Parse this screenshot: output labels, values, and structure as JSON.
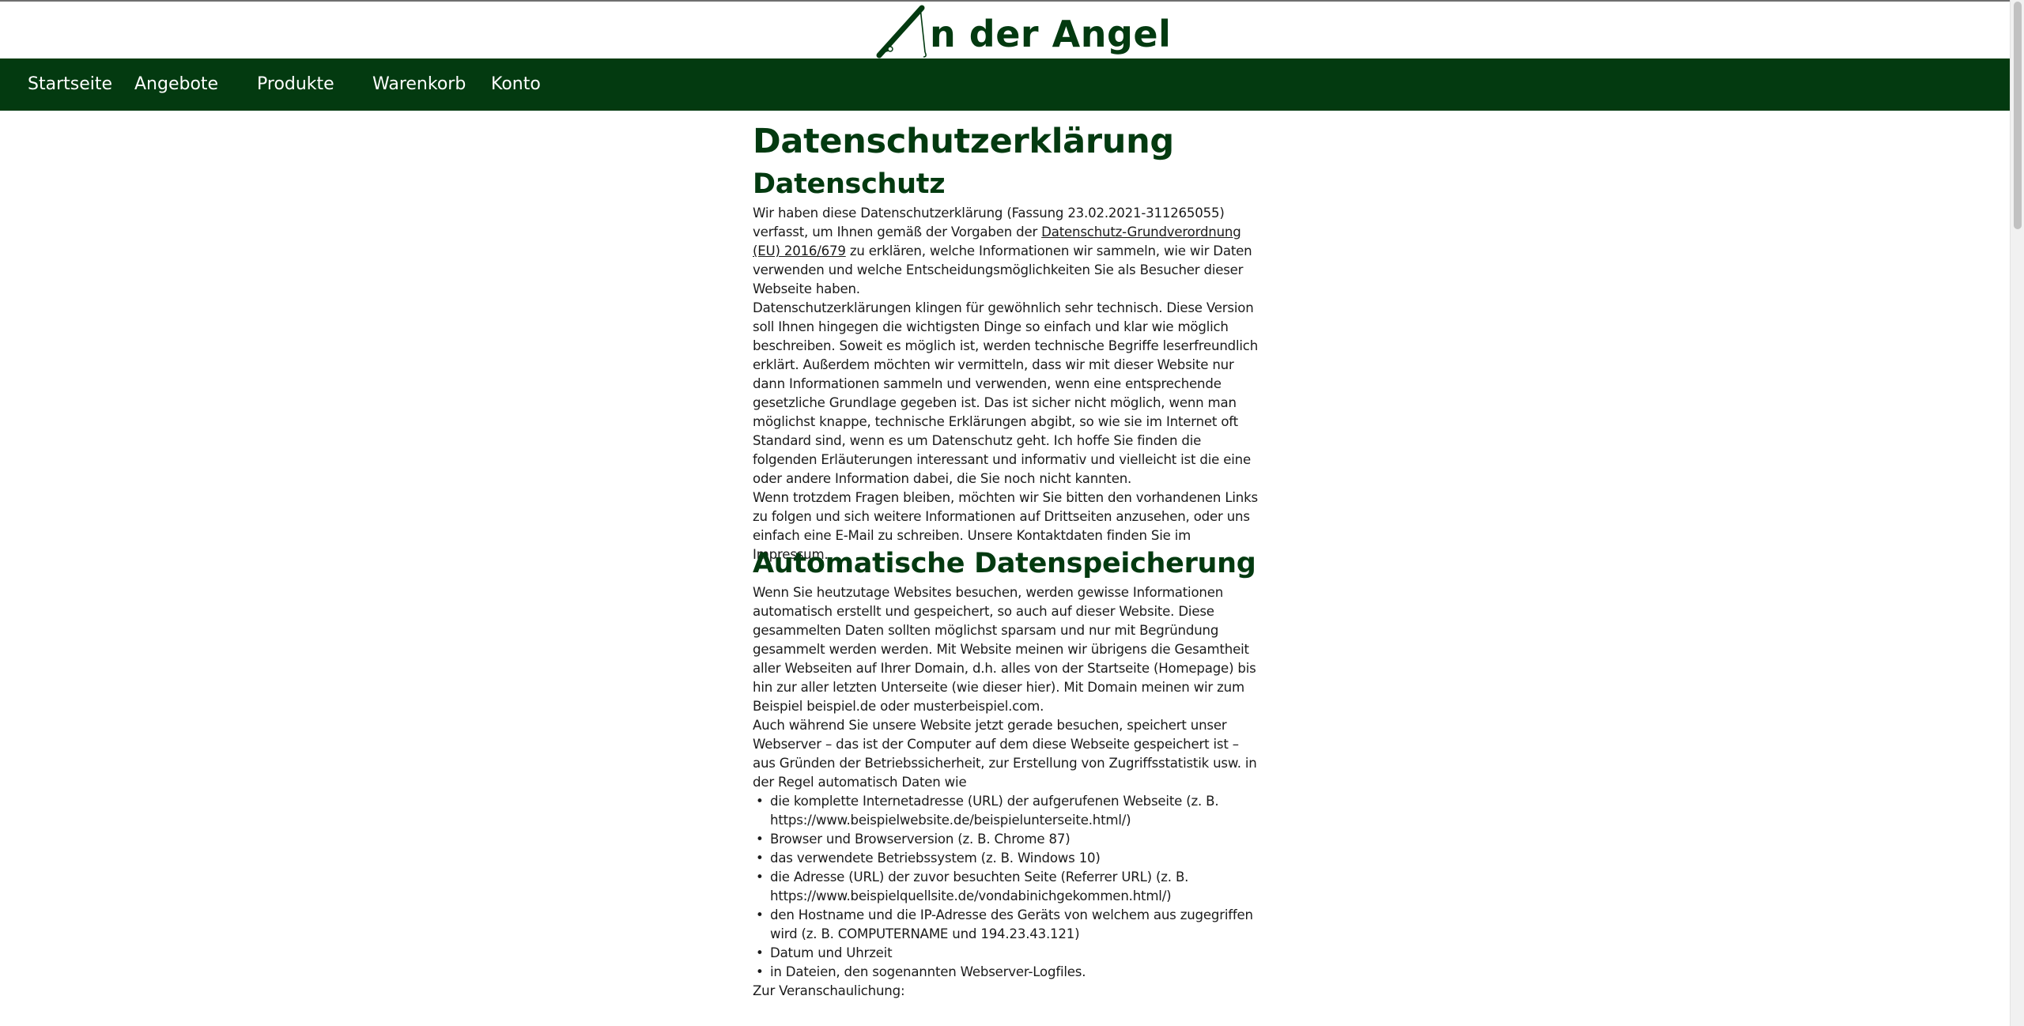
{
  "site": {
    "logo_text": "n der Angel",
    "logo_icon": "fishing-rod-icon",
    "brand_color": "#033a10"
  },
  "nav": {
    "items": [
      {
        "label": "Startseite"
      },
      {
        "label": "Angebote"
      },
      {
        "label": "Produkte"
      },
      {
        "label": "Warenkorb"
      },
      {
        "label": "Konto"
      }
    ]
  },
  "page": {
    "title": "Datenschutzerklärung",
    "sections": [
      {
        "heading": "Datenschutz",
        "p1_before": "Wir haben diese Datenschutzerklärung (Fassung 23.02.2021-311265055) verfasst, um Ihnen gemäß der Vorgaben der ",
        "p1_link": "Datenschutz-Grundverordnung (EU) 2016/679",
        "p1_after": " zu erklären, welche Informationen wir sammeln, wie wir Daten verwenden und welche Entscheidungsmöglichkeiten Sie als Besucher dieser Webseite haben.",
        "p2": "Datenschutzerklärungen klingen für gewöhnlich sehr technisch. Diese Version soll Ihnen hingegen die wichtigsten Dinge so einfach und klar wie möglich beschreiben. Soweit es möglich ist, werden technische Begriffe leserfreundlich erklärt. Außerdem möchten wir vermitteln, dass wir mit dieser Website nur dann Informationen sammeln und verwenden, wenn eine entsprechende gesetzliche Grundlage gegeben ist. Das ist sicher nicht möglich, wenn man möglichst knappe, technische Erklärungen abgibt, so wie sie im Internet oft Standard sind, wenn es um Datenschutz geht. Ich hoffe Sie finden die folgenden Erläuterungen interessant und informativ und vielleicht ist die eine oder andere Information dabei, die Sie noch nicht kannten.",
        "p3": "Wenn trotzdem Fragen bleiben, möchten wir Sie bitten den vorhandenen Links zu folgen und sich weitere Informationen auf Drittseiten anzusehen, oder uns einfach eine E-Mail zu schreiben. Unsere Kontaktdaten finden Sie im Impressum."
      },
      {
        "heading": "Automatische Datenspeicherung",
        "p1": "Wenn Sie heutzutage Websites besuchen, werden gewisse Informationen automatisch erstellt und gespeichert, so auch auf dieser Website. Diese gesammelten Daten sollten möglichst sparsam und nur mit Begründung gesammelt werden werden. Mit Website meinen wir übrigens die Gesamtheit aller Webseiten auf Ihrer Domain, d.h. alles von der Startseite (Homepage) bis hin zur aller letzten Unterseite (wie dieser hier). Mit Domain meinen wir zum Beispiel beispiel.de oder musterbeispiel.com.",
        "p2": "Auch während Sie unsere Website jetzt gerade besuchen, speichert unser Webserver – das ist der Computer auf dem diese Webseite gespeichert ist –  aus Gründen der Betriebssicherheit, zur Erstellung von Zugriffsstatistik usw. in der Regel automatisch Daten wie",
        "bullets": [
          "die komplette Internetadresse (URL) der aufgerufenen Webseite (z. B. https://www.beispielwebsite.de/beispielunterseite.html/)",
          "Browser und Browserversion (z. B. Chrome 87)",
          "das verwendete Betriebssystem (z. B. Windows 10)",
          "die Adresse (URL) der zuvor besuchten Seite (Referrer URL) (z. B. https://www.beispielquellsite.de/vondabinichgekommen.html/)",
          "den Hostname und die IP-Adresse des Geräts von welchem aus zugegriffen wird (z. B. COMPUTERNAME und 194.23.43.121)",
          "Datum und Uhrzeit",
          "in Dateien, den sogenannten Webserver-Logfiles."
        ],
        "p3": "Zur Veranschaulichung:"
      }
    ]
  }
}
